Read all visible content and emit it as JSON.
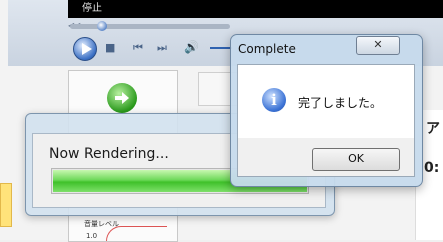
{
  "player": {
    "status_text": "停止",
    "seek_fraction": 0.2
  },
  "render_window": {
    "title": "Now Rendering...",
    "progress_fraction": 1.0
  },
  "dialog": {
    "title": "Complete",
    "message": "完了しました。",
    "close_symbol": "✕",
    "ok_label": "OK"
  },
  "background": {
    "right_char_top": "ア",
    "right_char_bottom": "0:",
    "chart_label": "音量レベル",
    "chart_tick": "1.0"
  },
  "colors": {
    "accent": "#3d74d6",
    "progress": "#3fc12a",
    "go_icon": "#2a9a1c"
  }
}
